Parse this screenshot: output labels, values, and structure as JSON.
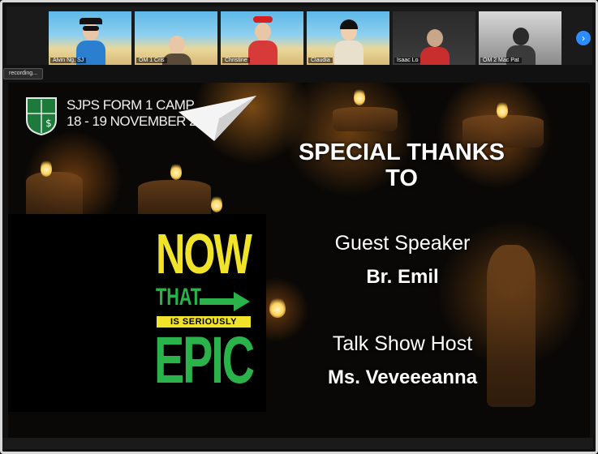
{
  "participants": [
    {
      "name": "Alvin Ng, SJ",
      "shirt": "#2a7fd0"
    },
    {
      "name": "OM 1 Cris",
      "shirt": "#5a4a3a"
    },
    {
      "name": "Christine",
      "shirt": "#d83a3a"
    },
    {
      "name": "Claudia",
      "shirt": "#e8e0cc"
    },
    {
      "name": "Isaac Lo",
      "shirt": "#c92e2e"
    },
    {
      "name": "OM 2 Mac Pat",
      "shirt": "#3a3a3a"
    }
  ],
  "status_text": "recording...",
  "slide": {
    "camp_title": "SJPS FORM 1 CAMP",
    "camp_dates": "18 - 19 NOVEMBER 2021",
    "thanks_line1": "SPECIAL THANKS",
    "thanks_line2": "TO",
    "epic_now": "NOW",
    "epic_that": "THAT",
    "epic_serious": "IS SERIOUSLY",
    "epic_word": "EPIC",
    "role1": "Guest Speaker",
    "name1": "Br. Emil",
    "role2": "Talk Show Host",
    "name2": "Ms. Veveeeanna"
  },
  "colors": {
    "epic_yellow": "#f1e32a",
    "epic_green": "#2ab34a",
    "accent_blue": "#2d8cff"
  }
}
